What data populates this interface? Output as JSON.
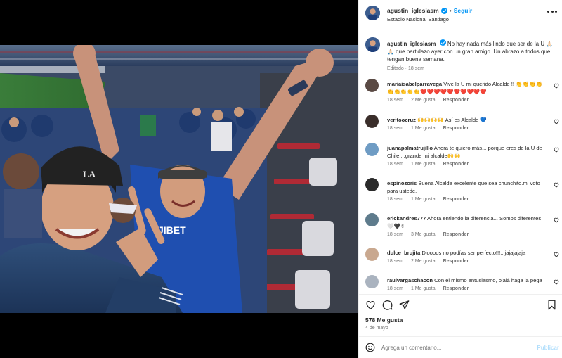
{
  "header": {
    "username": "agustin_iglesiasm",
    "separator": "•",
    "follow_label": "Seguir",
    "location": "Estadio Nacional Santiago"
  },
  "caption": {
    "username": "agustin_iglesiasm",
    "text": "No hay nada más lindo que ser de la U 🙏🏻🙏🏻 que partidazo ayer con un gran amigo. Un abrazo a todos que tengan buena semana.",
    "meta": "Editado · 18 sem"
  },
  "comments": [
    {
      "username": "mariaisabelparravega",
      "text": "Vive la U mi querido Alcalde !! 👏👏👏👏👏👏👏👏👏❤️❤️❤️❤️❤️❤️❤️❤️❤️❤️",
      "time": "18 sem",
      "likes": "2 Me gusta",
      "reply": "Responder"
    },
    {
      "username": "veritoocruz",
      "text": "🙌🙌🙌🙌 Así es Alcalde 💙",
      "time": "18 sem",
      "likes": "1 Me gusta",
      "reply": "Responder"
    },
    {
      "username": "juanapalmatrujillo",
      "text": "Ahora te quiero más... porque eres de la U de Chile....grande mi alcalde🙌🙌",
      "time": "18 sem",
      "likes": "1 Me gusta",
      "reply": "Responder"
    },
    {
      "username": "espinozoris",
      "text": "Buena Alcalde excelente que sea chunchito.mi voto para ustede.",
      "time": "18 sem",
      "likes": "1 Me gusta",
      "reply": "Responder"
    },
    {
      "username": "erickandres777",
      "text": "Ahora entiendo la diferencia... Somos diferentes 🤍🖤✌",
      "time": "18 sem",
      "likes": "3 Me gusta",
      "reply": "Responder"
    },
    {
      "username": "dulce_brujita",
      "text": "Dioooos no podías ser perfecto!!!...jajajajaja",
      "time": "18 sem",
      "likes": "2 Me gusta",
      "reply": "Responder"
    },
    {
      "username": "raulvargaschacon",
      "text": "Con el mismo entusiasmo, ojalá haga la pega",
      "time": "18 sem",
      "likes": "1 Me gusta",
      "reply": "Responder"
    }
  ],
  "actions": {
    "likes": "578 Me gusta",
    "date": "4 de mayo"
  },
  "add_comment": {
    "placeholder": "Agrega un comentario...",
    "post_label": "Publicar"
  },
  "icons": {
    "verified": "verified-badge-icon",
    "more": "more-options-icon",
    "like": "heart-icon",
    "comment": "comment-icon",
    "share": "share-icon",
    "save": "bookmark-icon",
    "emoji": "emoji-icon"
  },
  "colors": {
    "accent": "#0095f6",
    "muted": "#737373",
    "post_disabled": "#b2dffc"
  }
}
